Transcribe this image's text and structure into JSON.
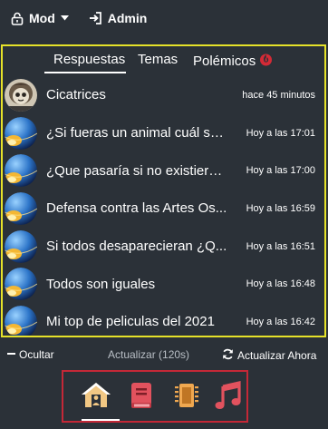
{
  "topbar": {
    "mod_label": "Mod",
    "admin_label": "Admin"
  },
  "tabs": {
    "answers": "Respuestas",
    "topics": "Temas",
    "controversial": "Polémicos"
  },
  "threads": [
    {
      "title": "Cicatrices",
      "time": "hace 45 minutos",
      "avatar": "character-avatar"
    },
    {
      "title": "¿Si fueras un animal cuál ser...",
      "time": "Hoy a las 17:01",
      "avatar": "planet-avatar"
    },
    {
      "title": "¿Que pasaría si no existieran...",
      "time": "Hoy a las 17:00",
      "avatar": "planet-avatar"
    },
    {
      "title": "Defensa contra las Artes Os...",
      "time": "Hoy a las 16:59",
      "avatar": "planet-avatar"
    },
    {
      "title": "Si todos desaparecieran ¿Q...",
      "time": "Hoy a las 16:51",
      "avatar": "planet-avatar"
    },
    {
      "title": "Todos son iguales",
      "time": "Hoy a las 16:48",
      "avatar": "planet-avatar"
    },
    {
      "title": "Mi top de peliculas del 2021",
      "time": "Hoy a las 16:42",
      "avatar": "planet-avatar"
    }
  ],
  "footer": {
    "hide_label": "Ocultar",
    "refresh_label": "Actualizar (120s)",
    "refresh_now_label": "Actualizar Ahora"
  },
  "colors": {
    "background": "#2b3138",
    "highlight_border": "#e6e229",
    "nav_border": "#c42837",
    "nav_red": "#e2525e",
    "home_accent": "#f2c884",
    "chip_accent": "#f0a850"
  },
  "icons": [
    "lock-icon",
    "chevron-down-icon",
    "login-icon",
    "fire-icon",
    "minus-icon",
    "refresh-icon",
    "home-icon",
    "book-icon",
    "chip-icon",
    "music-icon"
  ]
}
